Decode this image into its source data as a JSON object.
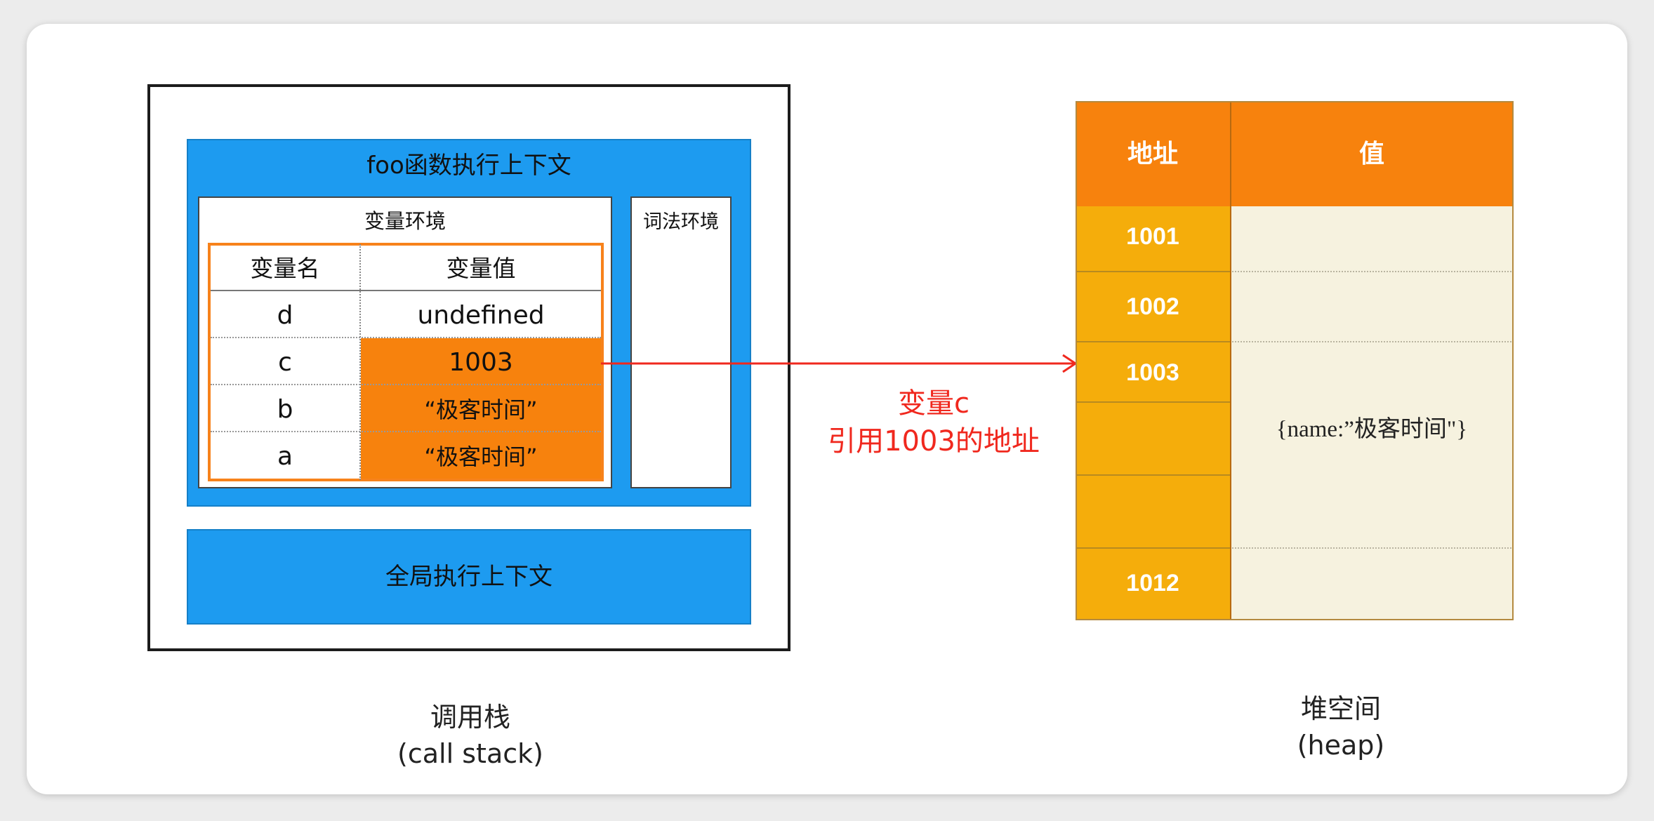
{
  "call_stack": {
    "foo_context_title": "foo函数执行上下文",
    "variable_environment": {
      "title": "变量环境",
      "header_name": "变量名",
      "header_value": "变量值",
      "rows": [
        {
          "name": "d",
          "value": "undefined"
        },
        {
          "name": "c",
          "value": "1003"
        },
        {
          "name": "b",
          "value": "“极客时间”"
        },
        {
          "name": "a",
          "value": "“极客时间”"
        }
      ]
    },
    "lexical_environment_title": "词法环境",
    "global_context_title": "全局执行上下文",
    "label": "调用栈",
    "label_en": "(call stack)"
  },
  "annotation": {
    "line1": "变量c",
    "line2": "引用1003的地址"
  },
  "heap": {
    "header_address": "地址",
    "header_value": "值",
    "addresses": [
      "1001",
      "1002",
      "1003",
      "",
      "",
      "1012"
    ],
    "object_value": "{name:”极客时间\"}",
    "label": "堆空间",
    "label_en": "(heap)"
  },
  "colors": {
    "context_blue": "#1d9bf0",
    "orange": "#f7820d",
    "address_gold": "#f5ad0b",
    "value_cream": "#f6f2df",
    "arrow_red": "#f0281e"
  }
}
